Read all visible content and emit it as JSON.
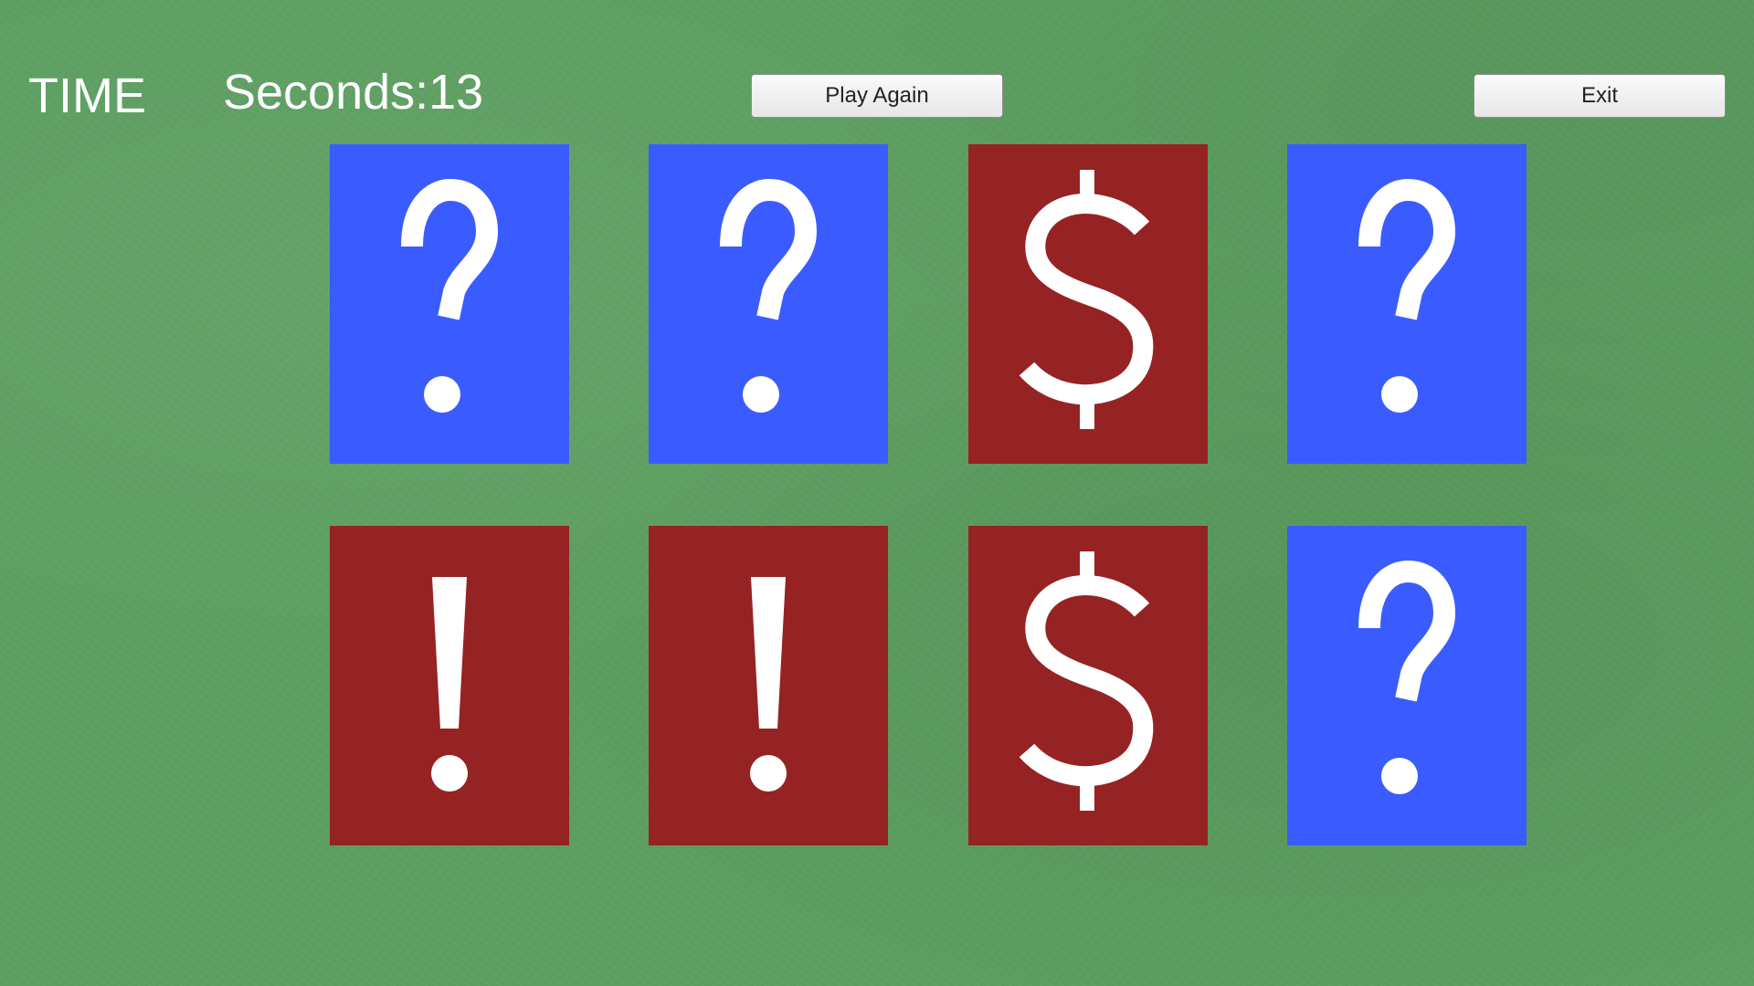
{
  "hud": {
    "time_label": "TIME",
    "seconds_label": "Seconds:13"
  },
  "buttons": {
    "play_again_label": "Play Again",
    "exit_label": "Exit"
  },
  "colors": {
    "background_felt": "#5c9e60",
    "card_back_blue": "#3a5cff",
    "card_face_red": "#962323",
    "symbol_white": "#ffffff"
  },
  "cards": [
    {
      "state": "face-down",
      "symbol": "question-mark"
    },
    {
      "state": "face-down",
      "symbol": "question-mark"
    },
    {
      "state": "face-up",
      "symbol": "dollar-sign"
    },
    {
      "state": "face-down",
      "symbol": "question-mark"
    },
    {
      "state": "face-up",
      "symbol": "exclamation-mark"
    },
    {
      "state": "face-up",
      "symbol": "exclamation-mark"
    },
    {
      "state": "face-up",
      "symbol": "dollar-sign"
    },
    {
      "state": "face-down",
      "symbol": "question-mark"
    }
  ]
}
